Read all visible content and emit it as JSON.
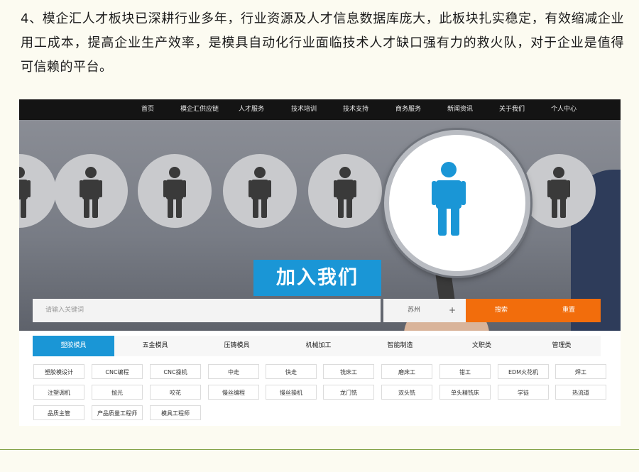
{
  "intro": "4、模企汇人才板块已深耕行业多年，行业资源及人才信息数据库庞大，此板块扎实稳定，有效缩减企业用工成本，提高企业生产效率，是模具自动化行业面临技术人才缺口强有力的救火队，对于企业是值得可信赖的平台。",
  "nav": {
    "items": [
      "首页",
      "模企汇供应链",
      "人才服务",
      "技术培训",
      "技术支持",
      "商务服务",
      "新闻资讯",
      "关于我们",
      "个人中心"
    ]
  },
  "hero": {
    "banner": "加入我们"
  },
  "search": {
    "placeholder": "请输入关键词",
    "city": "苏州",
    "plus": "+",
    "search_label": "搜索",
    "reset_label": "重置"
  },
  "tabs": [
    "塑胶模具",
    "五金模具",
    "压铸模具",
    "机械加工",
    "智能制造",
    "文职类",
    "管理类"
  ],
  "tags": [
    [
      "塑胶模设计",
      "CNC编程",
      "CNC操机",
      "中走",
      "快走",
      "铣床工",
      "磨床工",
      "钳工",
      "EDM火花机",
      "焊工"
    ],
    [
      "注塑调机",
      "抛光",
      "咬花",
      "慢丝编程",
      "慢丝操机",
      "龙门铣",
      "双头铣",
      "单头精铣床",
      "学徒",
      "热流道"
    ],
    [
      "品质主管",
      "产品质量工程师",
      "模具工程师"
    ]
  ],
  "colors": {
    "accent_blue": "#1a96d6",
    "search_orange": "#f26d0c",
    "nav_bg": "#141414"
  },
  "icons": {
    "person": "person-icon",
    "magnifier": "magnifier-icon",
    "plus": "plus-icon"
  }
}
